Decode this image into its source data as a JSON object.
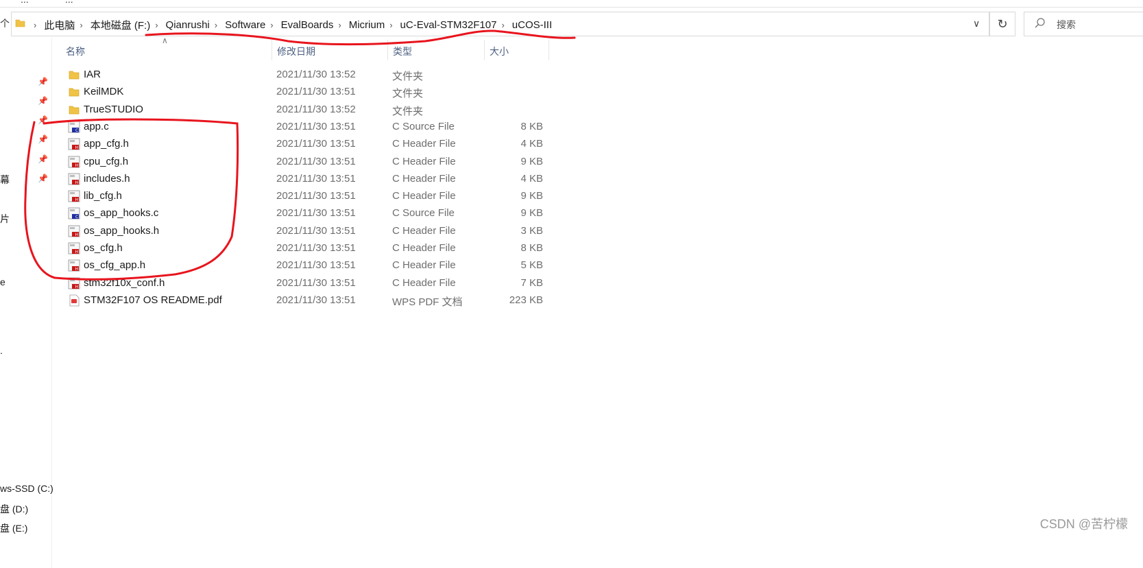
{
  "top_strip": {
    "left_text": "...",
    "mid_text": "..."
  },
  "nav_up_glyph": "个",
  "breadcrumbs": [
    "此电脑",
    "本地磁盘 (F:)",
    "Qianrushi",
    "Software",
    "EvalBoards",
    "Micrium",
    "uC-Eval-STM32F107",
    "uCOS-III"
  ],
  "search": {
    "placeholder": "搜索"
  },
  "columns": {
    "name": "名称",
    "date": "修改日期",
    "type": "类型",
    "size": "大小"
  },
  "navpane": {
    "partial_labels": [
      "幕",
      "片",
      "e",
      "."
    ],
    "drives": [
      "ws-SSD (C:)",
      "盘 (D:)",
      "盘 (E:)"
    ]
  },
  "files": [
    {
      "name": "IAR",
      "date": "2021/11/30 13:52",
      "type": "文件夹",
      "size": "",
      "icon": "folder-icon"
    },
    {
      "name": "KeilMDK",
      "date": "2021/11/30 13:51",
      "type": "文件夹",
      "size": "",
      "icon": "folder-icon"
    },
    {
      "name": "TrueSTUDIO",
      "date": "2021/11/30 13:52",
      "type": "文件夹",
      "size": "",
      "icon": "folder-icon"
    },
    {
      "name": "app.c",
      "date": "2021/11/30 13:51",
      "type": "C Source File",
      "size": "8 KB",
      "icon": "c-source-file-icon"
    },
    {
      "name": "app_cfg.h",
      "date": "2021/11/30 13:51",
      "type": "C Header File",
      "size": "4 KB",
      "icon": "c-header-file-icon"
    },
    {
      "name": "cpu_cfg.h",
      "date": "2021/11/30 13:51",
      "type": "C Header File",
      "size": "9 KB",
      "icon": "c-header-file-icon"
    },
    {
      "name": "includes.h",
      "date": "2021/11/30 13:51",
      "type": "C Header File",
      "size": "4 KB",
      "icon": "c-header-file-icon"
    },
    {
      "name": "lib_cfg.h",
      "date": "2021/11/30 13:51",
      "type": "C Header File",
      "size": "9 KB",
      "icon": "c-header-file-icon"
    },
    {
      "name": "os_app_hooks.c",
      "date": "2021/11/30 13:51",
      "type": "C Source File",
      "size": "9 KB",
      "icon": "c-source-file-icon"
    },
    {
      "name": "os_app_hooks.h",
      "date": "2021/11/30 13:51",
      "type": "C Header File",
      "size": "3 KB",
      "icon": "c-header-file-icon"
    },
    {
      "name": "os_cfg.h",
      "date": "2021/11/30 13:51",
      "type": "C Header File",
      "size": "8 KB",
      "icon": "c-header-file-icon"
    },
    {
      "name": "os_cfg_app.h",
      "date": "2021/11/30 13:51",
      "type": "C Header File",
      "size": "5 KB",
      "icon": "c-header-file-icon"
    },
    {
      "name": "stm32f10x_conf.h",
      "date": "2021/11/30 13:51",
      "type": "C Header File",
      "size": "7 KB",
      "icon": "c-header-file-icon"
    },
    {
      "name": "STM32F107 OS README.pdf",
      "date": "2021/11/30 13:51",
      "type": "WPS PDF 文档",
      "size": "223 KB",
      "icon": "pdf-file-icon"
    }
  ],
  "watermark": "CSDN @苦柠檬",
  "colors": {
    "annotation_red": "#e8141d",
    "folder_yellow": "#f0c347",
    "header_blue": "#4d6082"
  }
}
